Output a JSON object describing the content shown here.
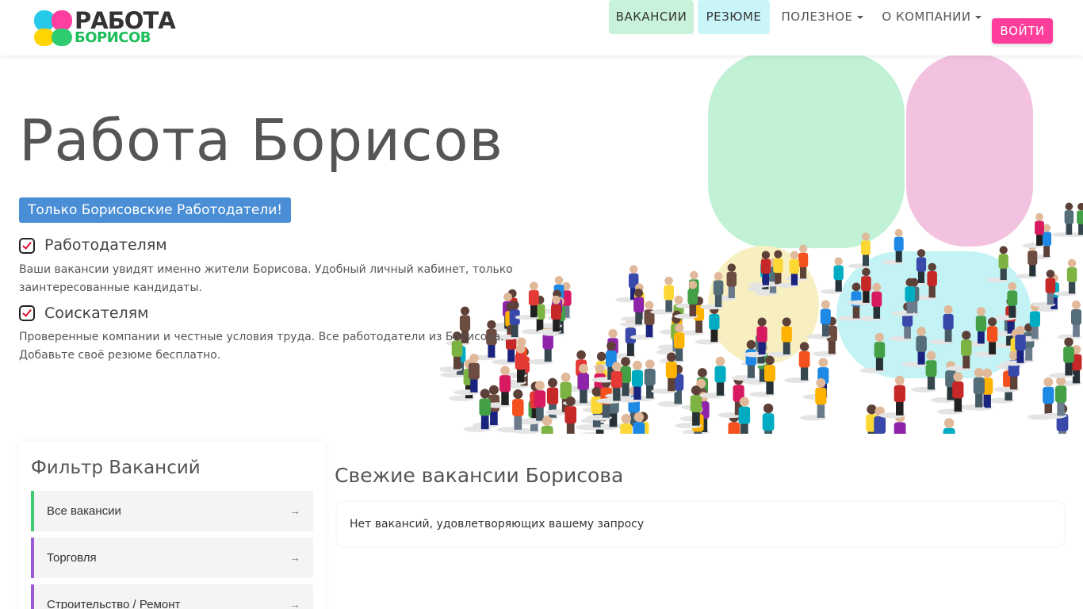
{
  "logo": {
    "line1": "РАБОТА",
    "line2": "БОРИСОВ"
  },
  "nav": {
    "vacancies": "ВАКАНСИИ",
    "resume": "РЕЗЮМЕ",
    "useful": "ПОЛЕЗНОЕ",
    "company": "О КОМПАНИИ",
    "login": "ВОЙТИ"
  },
  "hero": {
    "title": "Работа Борисов",
    "badge": "Только Борисовские Работодатели!",
    "features": [
      {
        "title": "Работодателям",
        "text": "Ваши вакансии увидят именно жители Борисова. Удобный личный кабинет, только заинтересованные кандидаты."
      },
      {
        "title": "Соискателям",
        "text": "Проверенные компании и честные условия труда. Все работодатели из Борисова. Добавьте своё резюме бесплатно."
      }
    ]
  },
  "filter": {
    "title": "Фильтр Вакансий",
    "items": [
      {
        "label": "Все вакансии",
        "arrow": "→"
      },
      {
        "label": "Торговля",
        "arrow": "→"
      },
      {
        "label": "Строительство / Ремонт",
        "arrow": "→"
      }
    ]
  },
  "listing": {
    "title": "Свежие вакансии Борисова",
    "empty": "Нет вакансий, удовлетворяющих вашему запросу"
  },
  "colors": {
    "accent_pink": "#ff3d9a",
    "badge_blue": "#4a8ed5",
    "nav_green": "#c8f3da",
    "nav_cyan": "#c9f4f8"
  }
}
